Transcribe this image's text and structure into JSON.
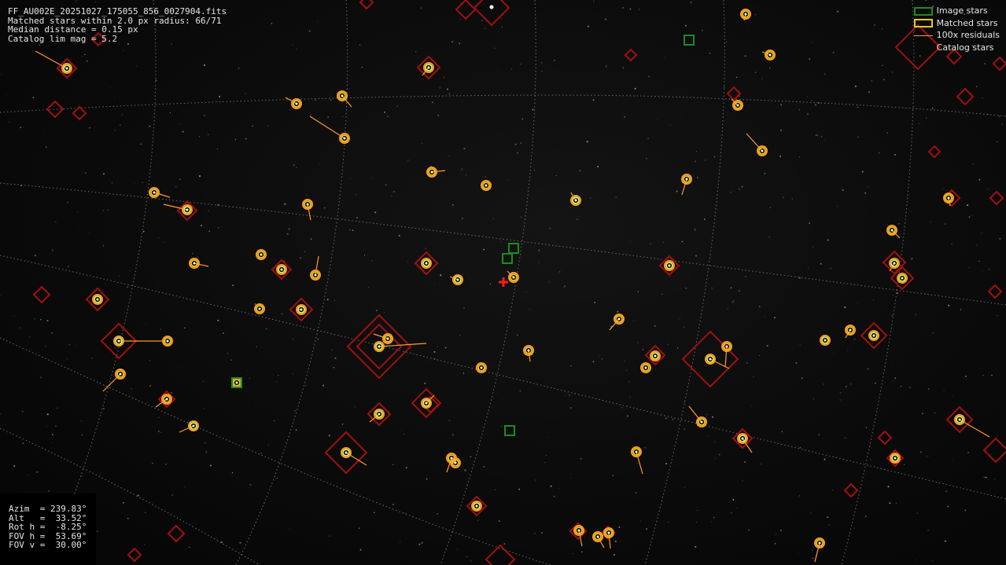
{
  "header": {
    "filename": "FF_AU002E_20251027_175055_856_0027904.fits",
    "matched_line": "Matched stars within 2.0 px radius: 66/71",
    "median_line": "Median distance = 0.15 px",
    "catalog_line": "Catalog lim mag = 5.2"
  },
  "legend": {
    "image_stars": "Image stars",
    "matched_stars": "Matched stars",
    "residuals": "100x residuals",
    "catalog_stars": "Catalog stars"
  },
  "pointing": {
    "azim": "Azim  = 239.83°",
    "alt": "Alt   =  33.52°",
    "rot": "Rot h =  -8.25°",
    "fov_h": "FOV h =  53.69°",
    "fov_v": "FOV v =  30.00°"
  },
  "colors": {
    "image_star_box": "#1f8a1f",
    "matched_star_box": "#e8c81a",
    "residual_line": "#ff9a2e",
    "catalog_star": "#a01010",
    "center_cross": "#ff1a1a",
    "grid": "#7a7a7a"
  },
  "icons": {
    "center": "red-plus-cross-icon",
    "image_star": "green-square-icon",
    "matched_star": "yellow-ring-icon",
    "catalog_star": "red-diamond-icon"
  }
}
